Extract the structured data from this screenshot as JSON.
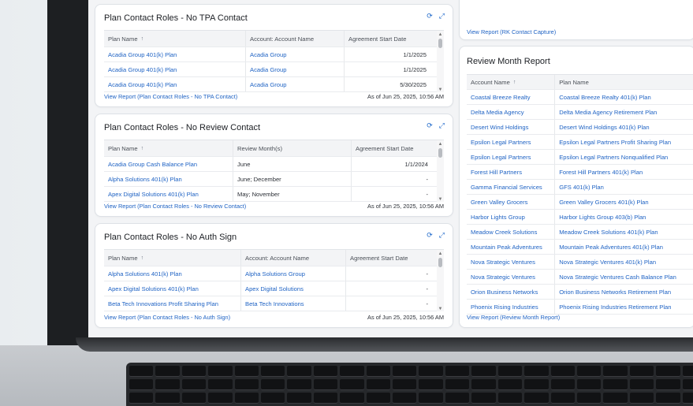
{
  "dashboard": {
    "panels": [
      {
        "title": "Plan Contact Roles - No TPA Contact",
        "columns": [
          "Plan Name",
          "Account: Account Name",
          "Agreement Start Date"
        ],
        "rows": [
          [
            "Acadia Group 401(k) Plan",
            "Acadia Group",
            "1/1/2025"
          ],
          [
            "Acadia Group 401(k) Plan",
            "Acadia Group",
            "1/1/2025"
          ],
          [
            "Acadia Group 401(k) Plan",
            "Acadia Group",
            "5/30/2025"
          ]
        ],
        "footer_link": "View Report (Plan Contact Roles - No TPA Contact)",
        "timestamp": "As of Jun 25, 2025, 10:56 AM"
      },
      {
        "title": "Plan Contact Roles - No Review Contact",
        "columns": [
          "Plan Name",
          "Review Month(s)",
          "Agreement Start Date"
        ],
        "rows": [
          [
            "Acadia Group Cash Balance Plan",
            "June",
            "1/1/2024"
          ],
          [
            "Alpha Solutions 401(k) Plan",
            "June; December",
            "-"
          ],
          [
            "Apex Digital Solutions 401(k) Plan",
            "May; November",
            "-"
          ]
        ],
        "footer_link": "View Report (Plan Contact Roles - No Review Contact)",
        "timestamp": "As of Jun 25, 2025, 10:56 AM"
      },
      {
        "title": "Plan Contact Roles - No Auth Sign",
        "columns": [
          "Plan Name",
          "Account: Account Name",
          "Agreement Start Date"
        ],
        "rows": [
          [
            "Alpha Solutions 401(k) Plan",
            "Alpha Solutions Group",
            "-"
          ],
          [
            "Apex Digital Solutions 401(k) Plan",
            "Apex Digital Solutions",
            "-"
          ],
          [
            "Beta Tech Innovations Profit Sharing Plan",
            "Beta Tech Innovations",
            "-"
          ]
        ],
        "footer_link": "View Report (Plan Contact Roles - No Auth Sign)",
        "timestamp": "As of Jun 25, 2025, 10:56 AM"
      }
    ],
    "rk_capture": {
      "footer_link": "View Report (RK Contact Capture)"
    },
    "review_month": {
      "title": "Review Month Report",
      "columns": [
        "Account Name",
        "Plan Name"
      ],
      "rows": [
        [
          "Coastal Breeze Realty",
          "Coastal Breeze Realty 401(k) Plan"
        ],
        [
          "Delta Media Agency",
          "Delta Media Agency Retirement Plan"
        ],
        [
          "Desert Wind Holdings",
          "Desert Wind Holdings 401(k) Plan"
        ],
        [
          "Epsilon Legal Partners",
          "Epsilon Legal Partners Profit Sharing Plan"
        ],
        [
          "Epsilon Legal Partners",
          "Epsilon Legal Partners Nonqualified Plan"
        ],
        [
          "Forest Hill Partners",
          "Forest Hill Partners 401(k) Plan"
        ],
        [
          "Gamma Financial Services",
          "GFS 401(k) Plan"
        ],
        [
          "Green Valley Grocers",
          "Green Valley Grocers 401(k) Plan"
        ],
        [
          "Harbor Lights Group",
          "Harbor Lights Group 403(b) Plan"
        ],
        [
          "Meadow Creek Solutions",
          "Meadow Creek Solutions 401(k) Plan"
        ],
        [
          "Mountain Peak Adventures",
          "Mountain Peak Adventures 401(k) Plan"
        ],
        [
          "Nova Strategic Ventures",
          "Nova Strategic Ventures 401(k) Plan"
        ],
        [
          "Nova Strategic Ventures",
          "Nova Strategic Ventures Cash Balance Plan"
        ],
        [
          "Orion Business Networks",
          "Orion Business Networks Retirement Plan"
        ],
        [
          "Phoenix Rising Industries",
          "Phoenix Rising Industries Retirement Plan"
        ]
      ],
      "footer_link": "View Report (Review Month Report)"
    },
    "icons": {
      "refresh": "refresh-icon",
      "expand": "expand-icon",
      "sort": "sort-ascending-icon"
    },
    "colors": {
      "link": "#1f63c4",
      "panel": "#ffffff",
      "header_row": "#f3f4f6"
    }
  }
}
